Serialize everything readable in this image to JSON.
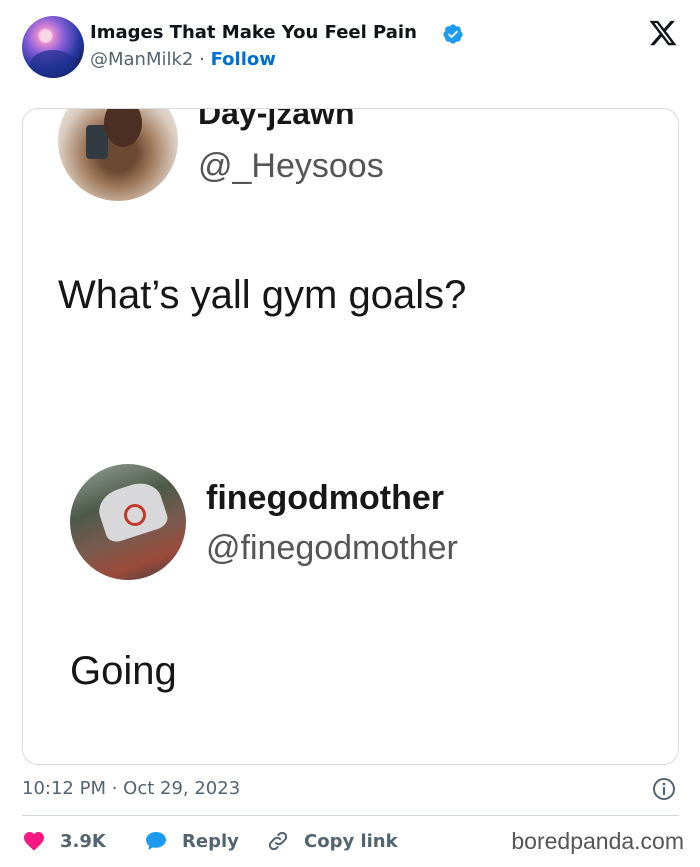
{
  "tweet": {
    "author_name": "Images That Make You Feel Pain",
    "handle": "@ManMilk2",
    "separator": "·",
    "follow_label": "Follow",
    "timestamp": "10:12 PM · Oct 29, 2023",
    "likes": "3.9K",
    "reply_label": "Reply",
    "copy_link_label": "Copy link"
  },
  "embedded": {
    "post1": {
      "name": "Day-jzawn",
      "handle": "@_Heysoos",
      "text": "What’s yall gym goals?"
    },
    "post2": {
      "name": "finegodmother",
      "handle": "@finegodmother",
      "text": "Going"
    }
  },
  "watermark": "boredpanda.com",
  "icons": [
    "verified-badge-icon",
    "x-logo-icon",
    "info-icon",
    "heart-icon",
    "reply-bubble-icon",
    "link-icon"
  ],
  "colors": {
    "verified": "#1d9bf0",
    "follow": "#006fd6",
    "heart": "#f91880",
    "reply": "#1d9bf0",
    "muted": "#536471"
  }
}
